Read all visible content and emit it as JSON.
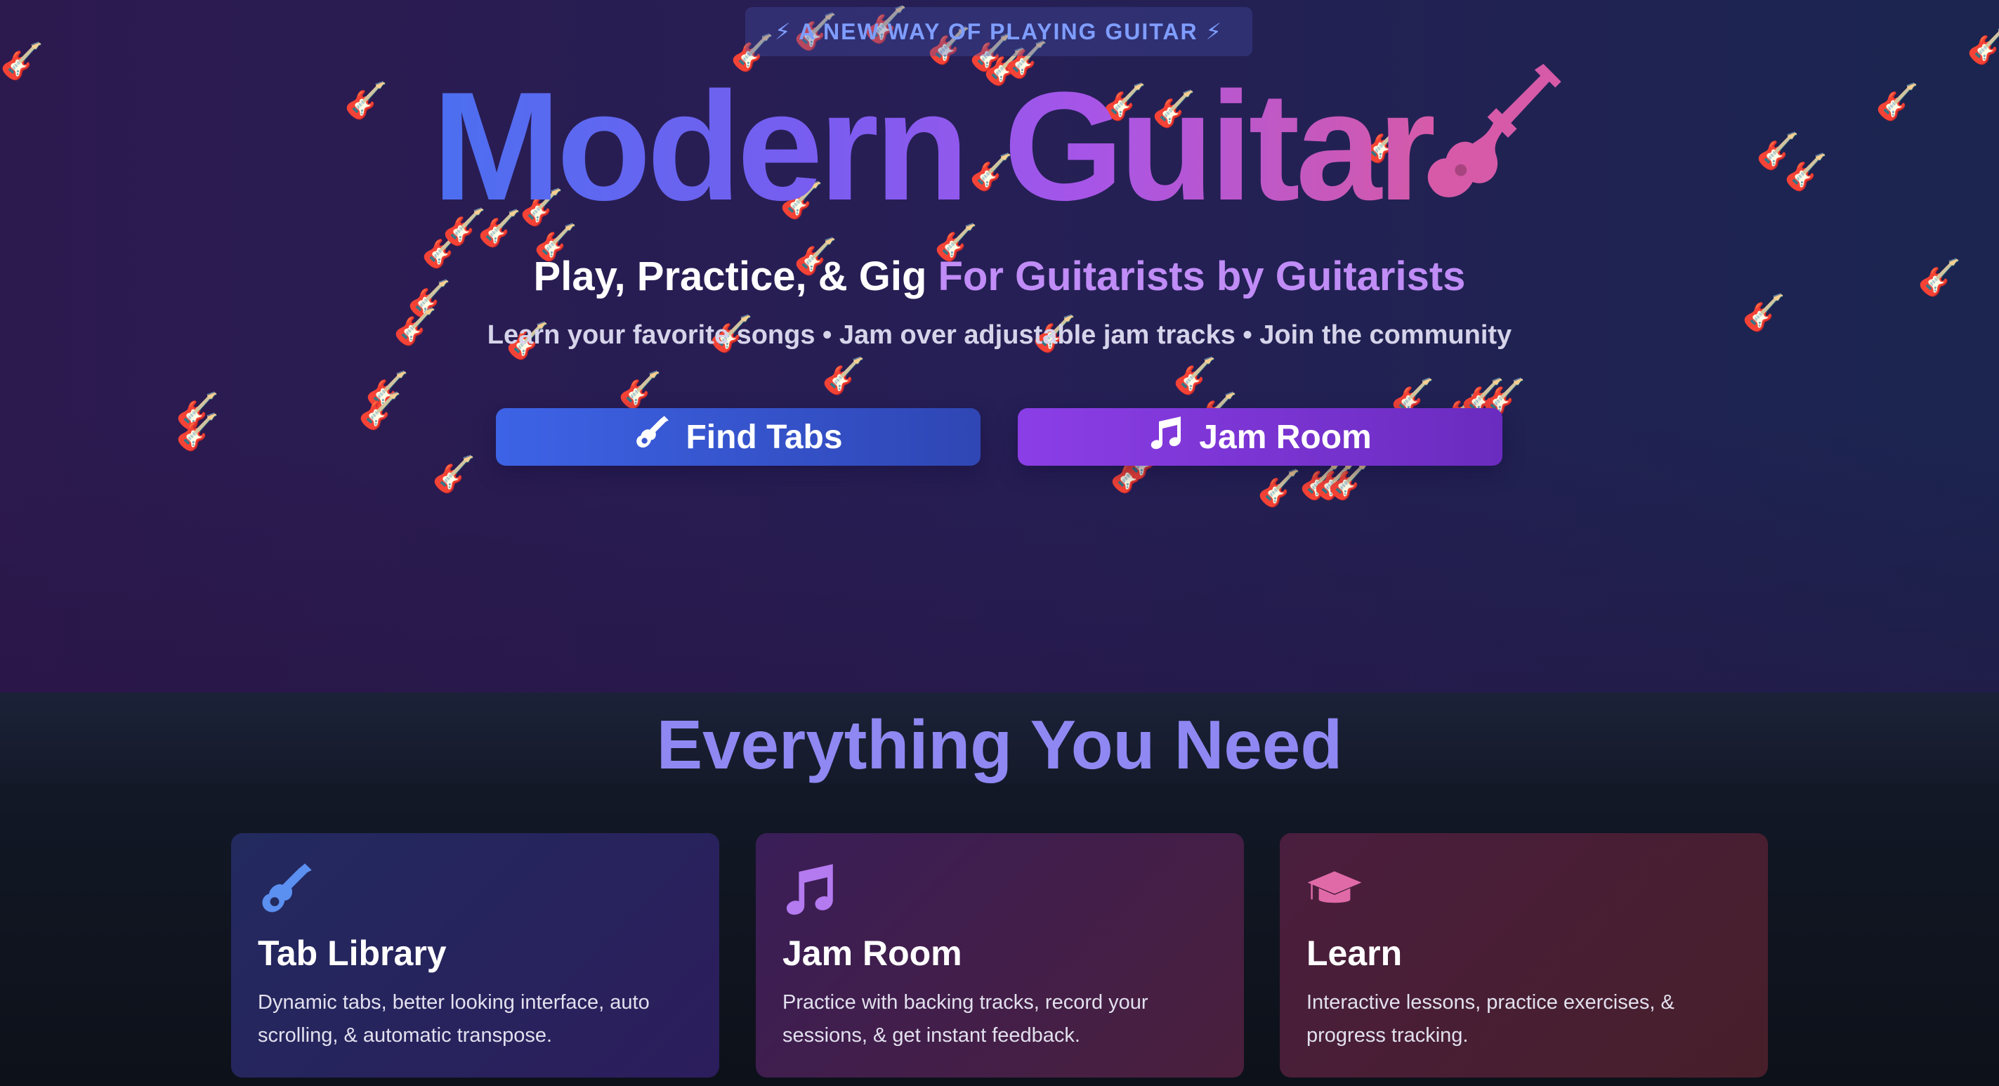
{
  "hero": {
    "badge": "⚡ A NEW WAY OF PLAYING GUITAR ⚡",
    "title": "Modern Guitar",
    "subtitle_main": "Play, Practice, & Gig",
    "subtitle_accent": "For Guitarists by Guitarists",
    "tagline": "Learn your favorite songs • Jam over adjustable jam tracks • Join the community",
    "buttons": [
      {
        "label": "Find Tabs",
        "icon": "guitar-icon"
      },
      {
        "label": "Jam Room",
        "icon": "music-note-icon"
      }
    ],
    "decoration_emoji": "🎸"
  },
  "features": {
    "heading": "Everything You Need",
    "cards": [
      {
        "title": "Tab Library",
        "text": "Dynamic tabs, better looking interface, auto scrolling, & automatic transpose.",
        "icon": "guitar-icon",
        "icon_color": "#5b8ff0"
      },
      {
        "title": "Jam Room",
        "text": "Practice with backing tracks, record your sessions, & get instant feedback.",
        "icon": "music-note-icon",
        "icon_color": "#b47af0"
      },
      {
        "title": "Learn",
        "text": "Interactive lessons, practice exercises, & progress tracking.",
        "icon": "graduation-cap-icon",
        "icon_color": "#e06aa8"
      }
    ]
  },
  "colors": {
    "accent_blue": "#3d63e6",
    "accent_purple": "#8b3ee6",
    "accent_pink": "#d65aa8",
    "heading_purple": "#8f88f2"
  }
}
